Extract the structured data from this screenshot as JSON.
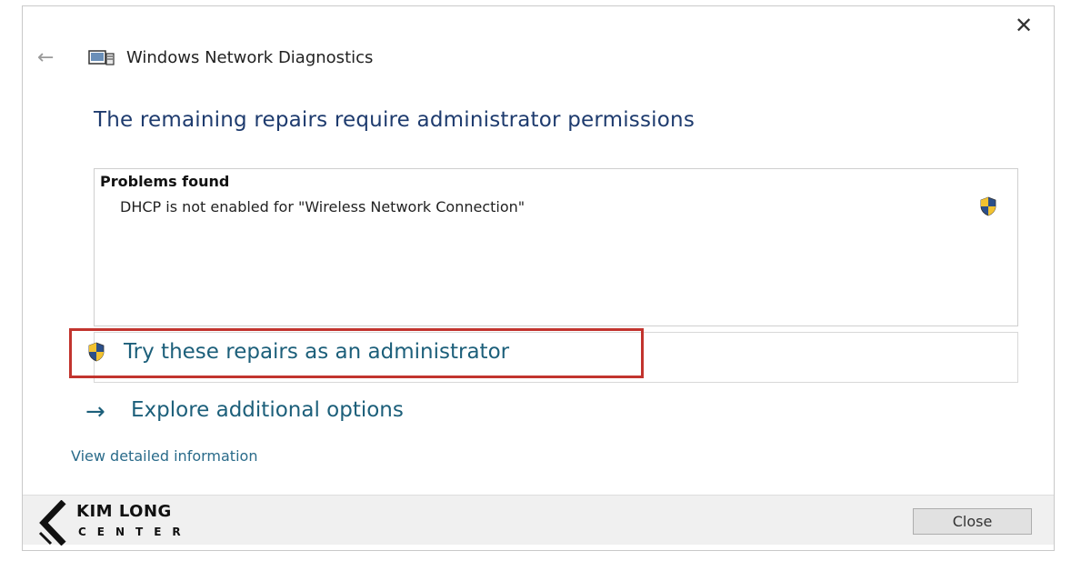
{
  "window": {
    "title": "Windows Network Diagnostics",
    "close_glyph": "✕",
    "back_glyph": "←"
  },
  "headline": "The remaining repairs require administrator permissions",
  "problems": {
    "header": "Problems found",
    "items": [
      {
        "text": "DHCP is not enabled for \"Wireless Network Connection\"",
        "icon": "uac-shield-icon"
      }
    ]
  },
  "actions": {
    "repair_label": "Try these repairs as an administrator",
    "explore_label": "Explore additional options",
    "explore_glyph": "→",
    "details_link": "View detailed information"
  },
  "footer": {
    "close_button": "Close"
  },
  "logo": {
    "line1": "KIM LONG",
    "line2": "CENTER"
  },
  "colors": {
    "headline": "#1e3b6e",
    "link": "#1c5f7a",
    "highlight_border": "#c2342e",
    "footer_bg": "#f0f0f0"
  }
}
